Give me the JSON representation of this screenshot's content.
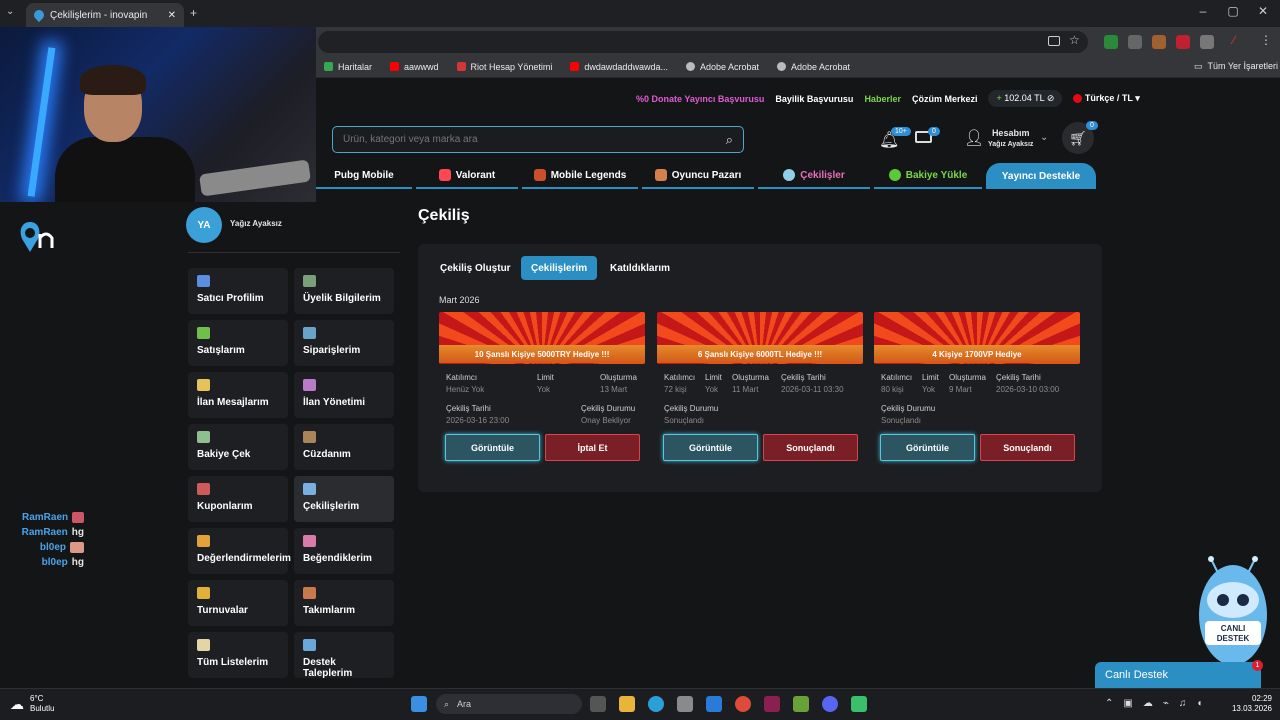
{
  "browser": {
    "tab_title": "Çekilişlerim - inovapin",
    "bookmarks": [
      {
        "label": "Haritalar",
        "color": "#34a853"
      },
      {
        "label": "aawwwd",
        "color": "#ff0000"
      },
      {
        "label": "Riot Hesap Yönetimi",
        "color": "#d13639"
      },
      {
        "label": "dwdawdaddwawda...",
        "color": "#ff0000"
      },
      {
        "label": "Adobe Acrobat",
        "color": "#bbbbbb"
      },
      {
        "label": "Adobe Acrobat",
        "color": "#bbbbbb"
      }
    ],
    "all_bookmarks": "Tüm Yer İşaretleri"
  },
  "top_links": {
    "donate": "%0 Donate Yayıncı Başvurusu",
    "dealer": "Bayilik Başvurusu",
    "news": "Haberler",
    "solution": "Çözüm Merkezi",
    "balance": "102.04 TL",
    "language": "Türkçe / TL"
  },
  "search": {
    "placeholder": "Ürün, kategori veya marka ara"
  },
  "header": {
    "notif_count": "10+",
    "mail_count": "0",
    "account_label": "Hesabım",
    "account_name": "Yağız Ayaksız",
    "cart_count": "0"
  },
  "categories": [
    {
      "label": "Pubg Mobile",
      "style": "",
      "icon_color": "#e6a33b"
    },
    {
      "label": "Valorant",
      "style": "",
      "icon_color": "#ff4655"
    },
    {
      "label": "Mobile Legends",
      "style": "",
      "icon_color": "#c9502a"
    },
    {
      "label": "Oyuncu Pazarı",
      "style": "",
      "icon_color": "#d4804c"
    },
    {
      "label": "Çekilişler",
      "style": "pink",
      "icon_color": "#8fd0e8"
    },
    {
      "label": "Bakiye Yükle",
      "style": "grn",
      "icon_color": "#5cc93a"
    },
    {
      "label": "Yayıncı Destekle",
      "style": "live",
      "icon_color": ""
    }
  ],
  "chat": [
    {
      "user": "RamRaen",
      "msg": "",
      "emote": true
    },
    {
      "user": "RamRaen",
      "msg": "hg",
      "emote": false
    },
    {
      "user": "bl0ep",
      "msg": "",
      "emote": true
    },
    {
      "user": "bl0ep",
      "msg": "hg",
      "emote": false
    }
  ],
  "profile": {
    "initials": "YA",
    "name": "Yağız Ayaksız"
  },
  "menu": [
    {
      "label": "Satıcı Profilim",
      "color": "#5b8de0"
    },
    {
      "label": "Üyelik Bilgilerim",
      "color": "#7aa07a"
    },
    {
      "label": "Satışlarım",
      "color": "#6fbf4a"
    },
    {
      "label": "Siparişlerim",
      "color": "#6aa3c8"
    },
    {
      "label": "İlan Mesajlarım",
      "color": "#e3c35a"
    },
    {
      "label": "İlan Yönetimi",
      "color": "#b97bc9"
    },
    {
      "label": "Bakiye Çek",
      "color": "#8fbf8f"
    },
    {
      "label": "Cüzdanım",
      "color": "#a8865a"
    },
    {
      "label": "Kuponlarım",
      "color": "#cf5a5a"
    },
    {
      "label": "Çekilişlerim",
      "color": "#7ab0e0"
    },
    {
      "label": "Değerlendirmelerim",
      "color": "#e3a13a"
    },
    {
      "label": "Beğendiklerim",
      "color": "#d97aa8"
    },
    {
      "label": "Turnuvalar",
      "color": "#e0b23a"
    },
    {
      "label": "Takımlarım",
      "color": "#c97a4a"
    },
    {
      "label": "Tüm Listelerim",
      "color": "#e3d5a6"
    },
    {
      "label": "Destek Taleplerim",
      "color": "#6aa8d9"
    }
  ],
  "main": {
    "title": "Çekiliş",
    "tabs": [
      "Çekiliş Oluştur",
      "Çekilişlerim",
      "Katıldıklarım"
    ],
    "active_tab": 1,
    "month": "Mart 2026",
    "cards": [
      {
        "title": "10 Şanslı Kişiye 5000TRY Hediye !!!",
        "row1": [
          [
            "Katılımcı",
            "Henüz Yok"
          ],
          [
            "Limit",
            "Yok"
          ],
          [
            "Oluşturma",
            "13 Mart"
          ]
        ],
        "row2": [
          [
            "Çekiliş Tarihi",
            "2026-03-16 23:00"
          ],
          [
            "Çekiliş Durumu",
            "Onay Bekliyor"
          ]
        ],
        "view": "Görüntüle",
        "action": "İptal Et"
      },
      {
        "title": "6 Şanslı Kişiye 6000TL Hediye !!!",
        "row1": [
          [
            "Katılımcı",
            "72 kişi"
          ],
          [
            "Limit",
            "Yok"
          ],
          [
            "Oluşturma",
            "11 Mart"
          ],
          [
            "Çekiliş Tarihi",
            "2026-03-11 03:30"
          ]
        ],
        "row2": [
          [
            "Çekiliş Durumu",
            "Sonuçlandı"
          ]
        ],
        "view": "Görüntüle",
        "action": "Sonuçlandı"
      },
      {
        "title": "4 Kişiye 1700VP Hediye",
        "row1": [
          [
            "Katılımcı",
            "80 kişi"
          ],
          [
            "Limit",
            "Yok"
          ],
          [
            "Oluşturma",
            "9 Mart"
          ],
          [
            "Çekiliş Tarihi",
            "2026-03-10 03:00"
          ]
        ],
        "row2": [
          [
            "Çekiliş Durumu",
            "Sonuçlandı"
          ]
        ],
        "view": "Görüntüle",
        "action": "Sonuçlandı"
      }
    ]
  },
  "support": {
    "mascot_text1": "CANLI",
    "mascot_text2": "DESTEK",
    "button": "Canlı Destek",
    "badge": "1"
  },
  "taskbar": {
    "temp": "6°C",
    "weather": "Bulutlu",
    "search": "Ara",
    "time": "02:29",
    "date": "13.03.2026"
  }
}
